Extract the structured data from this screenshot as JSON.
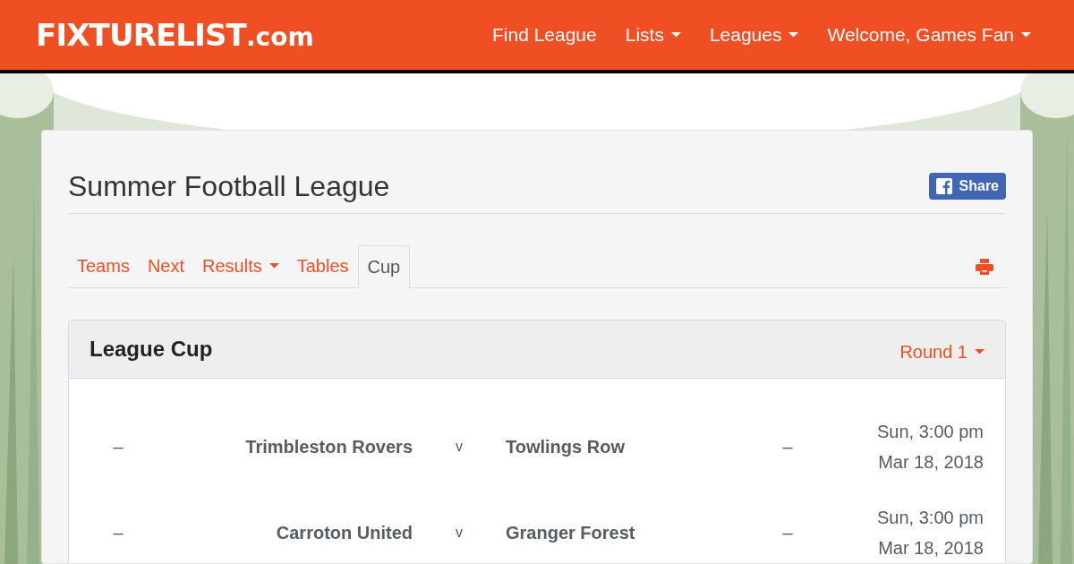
{
  "logo": {
    "text": "FIXTURELIST",
    "suffix": ".com"
  },
  "nav": [
    {
      "label": "Find League",
      "dropdown": false
    },
    {
      "label": "Lists",
      "dropdown": true
    },
    {
      "label": "Leagues",
      "dropdown": true
    },
    {
      "label": "Welcome, Games Fan",
      "dropdown": true
    }
  ],
  "page": {
    "title": "Summer Football League",
    "share": "Share"
  },
  "tabs": [
    {
      "label": "Teams",
      "selected": false,
      "dropdown": false
    },
    {
      "label": "Next",
      "selected": false,
      "dropdown": false
    },
    {
      "label": "Results",
      "selected": false,
      "dropdown": true
    },
    {
      "label": "Tables",
      "selected": false,
      "dropdown": false
    },
    {
      "label": "Cup",
      "selected": true,
      "dropdown": false
    }
  ],
  "panel": {
    "title": "League Cup",
    "round": "Round 1"
  },
  "fixtures": [
    {
      "home_score": "–",
      "home": "Trimbleston Rovers",
      "v": "v",
      "away": "Towlings Row",
      "away_score": "–",
      "day_time": "Sun, 3:00 pm",
      "date": "Mar 18, 2018"
    },
    {
      "home_score": "–",
      "home": "Carroton United",
      "v": "v",
      "away": "Granger Forest",
      "away_score": "–",
      "day_time": "Sun, 3:00 pm",
      "date": "Mar 18, 2018"
    }
  ]
}
